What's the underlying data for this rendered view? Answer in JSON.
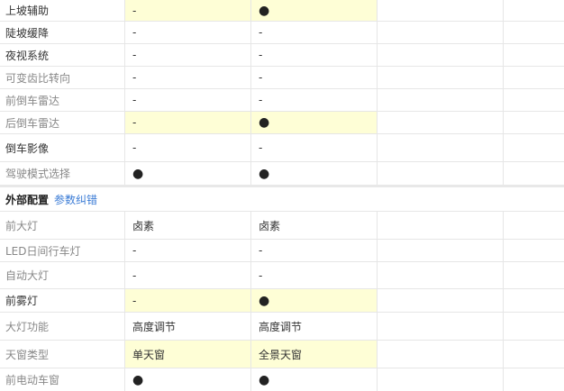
{
  "rows_top": [
    {
      "label": "上坡辅助",
      "v1": "-",
      "v2": "●",
      "v2_highlight": true
    },
    {
      "label": "陡坡缓降",
      "v1": "-",
      "v2": "-",
      "v2_highlight": false
    },
    {
      "label": "夜视系统",
      "v1": "-",
      "v2": "-",
      "v2_highlight": false
    },
    {
      "label": "可变齿比转向",
      "v1": "-",
      "v2": "-",
      "v2_highlight": false
    },
    {
      "label": "前倒车雷达",
      "v1": "-",
      "v2": "-",
      "v2_highlight": false
    },
    {
      "label": "后倒车雷达",
      "v1": "-",
      "v2": "●",
      "v2_highlight": true
    },
    {
      "label": "倒车影像",
      "v1": "-",
      "v2": "-",
      "v2_highlight": false
    },
    {
      "label": "驾驶模式选择",
      "v1": "●",
      "v2": "●",
      "v2_highlight": false
    }
  ],
  "section": {
    "title": "外部配置",
    "link": "参数纠错"
  },
  "rows_bottom": [
    {
      "label": "前大灯",
      "v1": "卤素",
      "v2": "卤素",
      "highlight": false
    },
    {
      "label": "LED日间行车灯",
      "v1": "-",
      "v2": "-",
      "highlight": false
    },
    {
      "label": "自动大灯",
      "v1": "-",
      "v2": "-",
      "highlight": false
    },
    {
      "label": "前雾灯",
      "v1": "-",
      "v2": "●",
      "highlight": true
    },
    {
      "label": "大灯功能",
      "v1": "高度调节",
      "v2": "高度调节",
      "highlight": false
    },
    {
      "label": "天窗类型",
      "v1": "单天窗",
      "v2": "全景天窗",
      "highlight": true
    },
    {
      "label": "前电动车窗",
      "v1": "●",
      "v2": "●",
      "highlight": false
    }
  ]
}
